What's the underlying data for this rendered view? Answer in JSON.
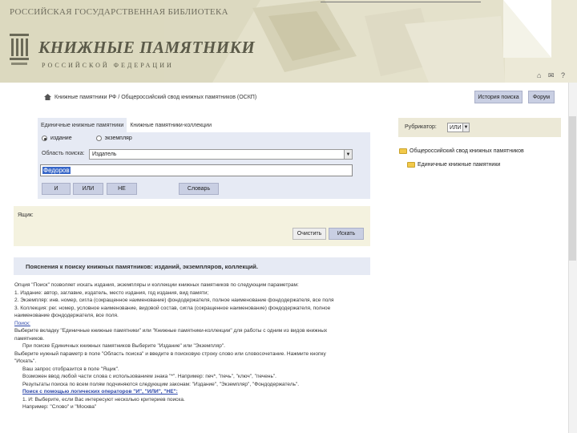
{
  "header": {
    "site_title": "РОССИЙСКАЯ ГОСУДАРСТВЕННАЯ БИБЛИОТЕКА",
    "brand_title": "КНИЖНЫЕ ПАМЯТНИКИ",
    "brand_subtitle": "РОССИЙСКОЙ ФЕДЕРАЦИИ",
    "icons_text": "⌂ ✉ ?"
  },
  "breadcrumb": {
    "text": "Книжные памятники РФ / Общероссийский свод книжных памятников (ОСКП)"
  },
  "top_buttons": {
    "history": "История поиска",
    "forum": "Форум"
  },
  "search": {
    "tabs": [
      "Единичные книжные памятники",
      "Книжные памятники-коллекции"
    ],
    "radio_edition": "издание",
    "radio_copy": "экземпляр",
    "area_label": "Область поиска:",
    "area_value": "Издатель",
    "query_value": "Федоров",
    "buttons": {
      "and": "И",
      "or": "ИЛИ",
      "not": "НЕ",
      "dictionary": "Словарь"
    }
  },
  "rubricator": {
    "label": "Рубрикатор:",
    "value": "ИЛИ",
    "tree": [
      "Общероссийский свод книжных памятников",
      "Единичные книжные памятники"
    ]
  },
  "cart": {
    "label": "Ящик:",
    "clear": "Очистить",
    "search": "Искать"
  },
  "help": {
    "title": "Пояснения к поиску книжных памятников: изданий, экземпляров, коллекций.",
    "lines": [
      {
        "text": "Опция \"Поиск\" позволяет искать издания, экземпляры и коллекции книжных памятников по следующим параметрам:",
        "style": ""
      },
      {
        "text": "1. Издание: автор, заглавие, издатель, место издания, год издания, вид памяти;",
        "style": ""
      },
      {
        "text": "2. Экземпляр: инв. номер, сигла (сокращенное наименование) фондодержателя, полное наименование фондодержателя, все поля",
        "style": ""
      },
      {
        "text": "3. Коллекция: рег. номер, условное наименование, видовой состав, сигла (сокращенное наименование) фондодержателя, полное",
        "style": ""
      },
      {
        "text": "наименование фондодержателя, все поля.",
        "style": ""
      },
      {
        "text": "Поиск:",
        "style": "link"
      },
      {
        "text": "Выберите вкладку \"Единичные книжные памятники\" или \"Книжные памятники-коллекции\" для работы с одним из видов книжных",
        "style": ""
      },
      {
        "text": "памятников.",
        "style": ""
      },
      {
        "text": "При поиске Единичных книжных памятников Выберите \"Издание\" или \"Экземпляр\".",
        "style": "indent"
      },
      {
        "text": "Выберите нужный параметр в поле \"Область поиска\" и введите в поисковую строку слово или словосочетание. Нажмите кнопку",
        "style": ""
      },
      {
        "text": "\"Искать\".",
        "style": ""
      },
      {
        "text": "Ваш запрос отобразится в поле \"Ящик\".",
        "style": "indent"
      },
      {
        "text": "Возможен ввод любой части слова с использованием знака \"*\". Например: печ*, \"печь\", \"ключ\", \"печень\".",
        "style": "indent"
      },
      {
        "text": "Результаты поиска по всем полям подчиняются следующим законам: \"Издание\", \"Экземпляр\", \"Фондодержатель\".",
        "style": "indent"
      },
      {
        "text": "Поиск с помощью логических операторов \"И\", \"ИЛИ\", \"НЕ\":",
        "style": "link bold indent"
      },
      {
        "text": "1. И: Выберите, если Вас интересуют несколько критериев поиска.",
        "style": "indent"
      },
      {
        "text": "Например: \"Слово\" и \"Москва\"",
        "style": "indent"
      }
    ]
  },
  "colors": {
    "header_bg": "#ece9d7",
    "panel_blue": "#e6eaf4",
    "button_blue": "#c9cfe3",
    "panel_beige": "#f4f2df",
    "link": "#2a45a8"
  }
}
